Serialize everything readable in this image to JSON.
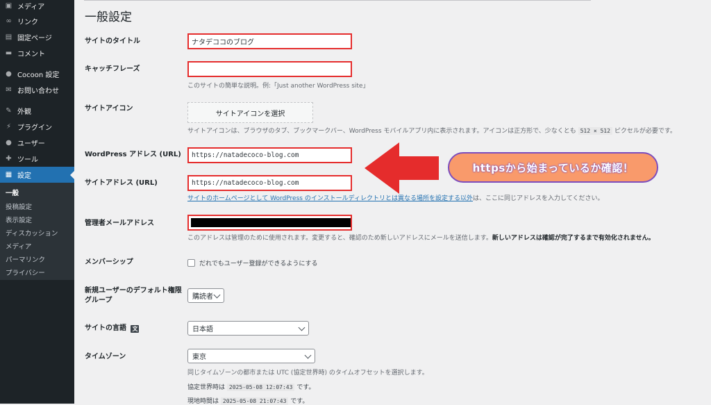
{
  "sidebar": {
    "items": [
      {
        "label": "メディア",
        "icon": "media-icon"
      },
      {
        "label": "リンク",
        "icon": "link-icon"
      },
      {
        "label": "固定ページ",
        "icon": "page-icon"
      },
      {
        "label": "コメント",
        "icon": "comment-icon"
      },
      {
        "label": "Cocoon 設定",
        "icon": "cocoon-icon"
      },
      {
        "label": "お問い合わせ",
        "icon": "mail-icon"
      },
      {
        "label": "外観",
        "icon": "appearance-icon"
      },
      {
        "label": "プラグイン",
        "icon": "plugin-icon"
      },
      {
        "label": "ユーザー",
        "icon": "user-icon"
      },
      {
        "label": "ツール",
        "icon": "tools-icon"
      },
      {
        "label": "設定",
        "icon": "settings-icon"
      }
    ],
    "submenu": [
      "一般",
      "投稿設定",
      "表示設定",
      "ディスカッション",
      "メディア",
      "パーマリンク",
      "プライバシー"
    ]
  },
  "page": {
    "title": "一般設定",
    "site_title_label": "サイトのタイトル",
    "site_title_value": "ナタデココのブログ",
    "tagline_label": "キャッチフレーズ",
    "tagline_value": "",
    "tagline_desc": "このサイトの簡単な説明。例:「Just another WordPress site」",
    "site_icon_label": "サイトアイコン",
    "site_icon_button": "サイトアイコンを選択",
    "site_icon_desc_a": "サイトアイコンは、ブラウザのタブ、ブックマークバー、WordPress モバイルアプリ内に表示されます。アイコンは正方形で、少なくとも",
    "site_icon_desc_code": "512 × 512",
    "site_icon_desc_b": "ピクセルが必要です。",
    "wp_address_label": "WordPress アドレス (URL)",
    "wp_address_value": "https://natadecoco-blog.com",
    "site_address_label": "サイトアドレス (URL)",
    "site_address_value": "https://natadecoco-blog.com",
    "site_address_link": "サイトのホームページとして WordPress のインストールディレクトリとは異なる場所を設定する以外",
    "site_address_desc": "は、ここに同じアドレスを入力してください。",
    "admin_email_label": "管理者メールアドレス",
    "admin_email_desc_a": "このアドレスは管理のために使用されます。変更すると、確認のため新しいアドレスにメールを送信します。",
    "admin_email_desc_b": "新しいアドレスは確認が完了するまで有効化されません。",
    "membership_label": "メンバーシップ",
    "membership_checkbox": "だれでもユーザー登録ができるようにする",
    "default_role_label": "新規ユーザーのデフォルト権限グループ",
    "default_role_value": "購読者",
    "language_label": "サイトの言語",
    "language_value": "日本語",
    "timezone_label": "タイムゾーン",
    "timezone_value": "東京",
    "timezone_desc": "同じタイムゾーンの都市または UTC (協定世界時) のタイムオフセットを選択します。",
    "utc_label": "協定世界時は",
    "utc_value": "2025-05-08 12:07:43",
    "utc_suffix": "です。",
    "local_label": "現地時間は",
    "local_value": "2025-05-08 21:07:43",
    "local_suffix": "です。"
  },
  "annotation": {
    "callout": "httpsから始まっているか確認！",
    "arrow_color": "#e52c2c",
    "callout_color": "#f99a6b",
    "callout_border": "#7c4dbd"
  },
  "colors": {
    "sidebar_bg": "#1d2327",
    "accent": "#2271b1",
    "highlight": "#e52c2c"
  }
}
